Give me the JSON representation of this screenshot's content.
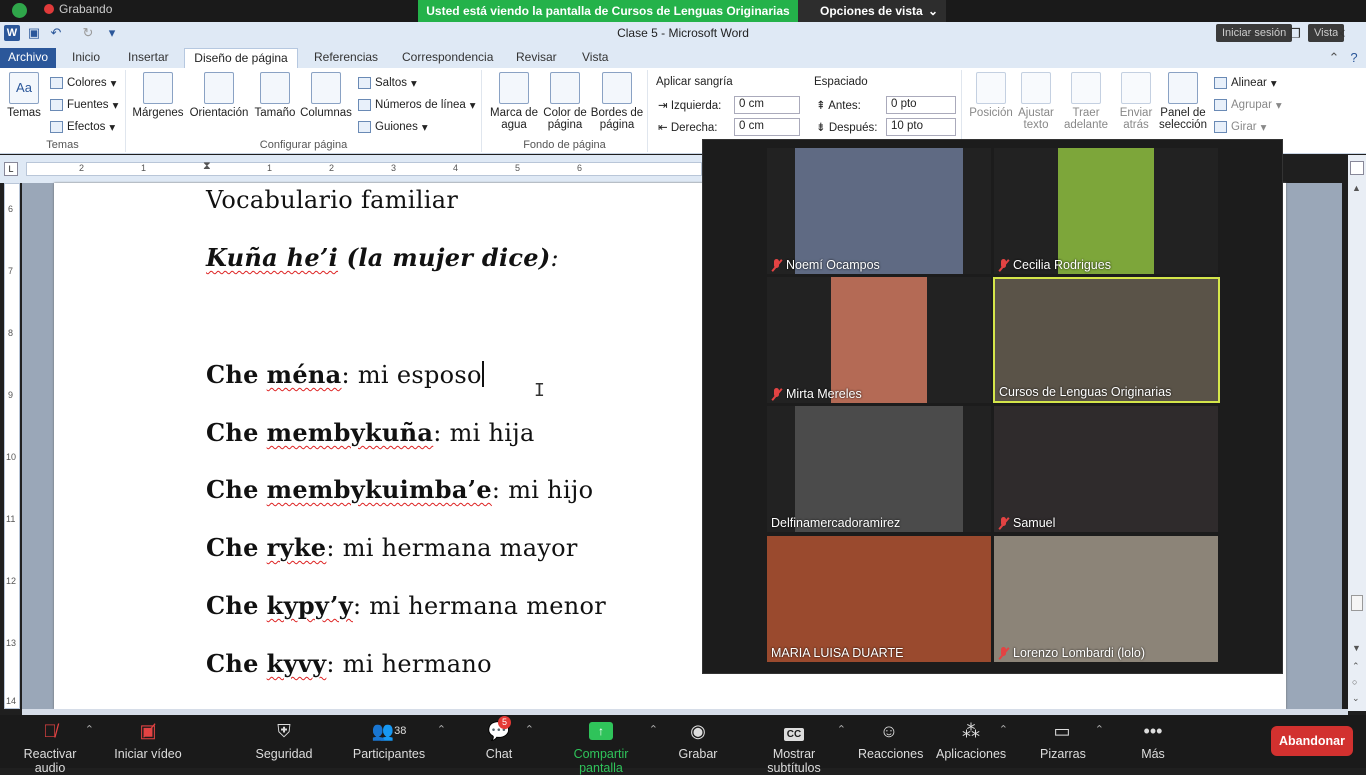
{
  "zoom_top": {
    "recording_label": "Grabando",
    "share_banner": "Usted está viendo la pantalla de Cursos de Lenguas Originarias",
    "view_options": "Opciones de vista",
    "sign_in": "Iniciar sesión",
    "view": "Vista"
  },
  "word": {
    "title": "Clase 5 - Microsoft Word",
    "tabs": [
      "Archivo",
      "Inicio",
      "Insertar",
      "Diseño de página",
      "Referencias",
      "Correspondencia",
      "Revisar",
      "Vista"
    ],
    "active_tab": "Diseño de página"
  },
  "ribbon": {
    "themes": {
      "temas": "Temas",
      "colores": "Colores",
      "fuentes": "Fuentes",
      "efectos": "Efectos",
      "group": "Temas"
    },
    "page_setup": {
      "margenes": "Márgenes",
      "orientacion": "Orientación",
      "tamano": "Tamaño",
      "columnas": "Columnas",
      "saltos": "Saltos",
      "numeros_linea": "Números de línea",
      "guiones": "Guiones",
      "group": "Configurar página"
    },
    "background": {
      "marca_agua_1": "Marca de",
      "marca_agua_2": "agua",
      "color_pagina_1": "Color de",
      "color_pagina_2": "página",
      "bordes_1": "Bordes de",
      "bordes_2": "página",
      "group": "Fondo de página"
    },
    "paragraph": {
      "sangria": "Aplicar sangría",
      "izquierda": "Izquierda:",
      "izquierda_val": "0 cm",
      "derecha": "Derecha:",
      "derecha_val": "0 cm",
      "espaciado": "Espaciado",
      "antes": "Antes:",
      "antes_val": "0 pto",
      "despues": "Después:",
      "despues_val": "10 pto"
    },
    "arrange": {
      "posicion": "Posición",
      "ajustar_1": "Ajustar",
      "ajustar_2": "texto",
      "traer_1": "Traer",
      "traer_2": "adelante",
      "enviar_1": "Enviar",
      "enviar_2": "atrás",
      "panel_1": "Panel de",
      "panel_2": "selección",
      "alinear": "Alinear",
      "agrupar": "Agrupar",
      "girar": "Girar"
    }
  },
  "ruler_numbers": [
    "2",
    "1",
    "1",
    "2",
    "3",
    "4",
    "5",
    "6"
  ],
  "vruler_numbers": [
    "6",
    "7",
    "8",
    "9",
    "10",
    "11",
    "12",
    "13",
    "14"
  ],
  "document": {
    "title": "Vocabulario familiar",
    "subtitle_bold": "Kuña he’i",
    "subtitle_rest": " (la mujer dice)",
    "subtitle_colon": ":",
    "lines": [
      {
        "che": "Che",
        "word": "ména",
        "rest": ": mi esposo"
      },
      {
        "che": "Che",
        "word": "membykuña",
        "rest": ": mi hija"
      },
      {
        "che": "Che",
        "word": "membykuimba’e",
        "rest": ": mi hijo"
      },
      {
        "che": "Che",
        "word": "ryke",
        "rest": ": mi hermana mayor"
      },
      {
        "che": "Che",
        "word": "kypy’y",
        "rest": ": mi hermana menor"
      },
      {
        "che": "Che",
        "word": "kyvy",
        "rest": ": mi hermano"
      }
    ]
  },
  "participants_tiles": [
    {
      "name": "Noemí Ocampos",
      "muted": true
    },
    {
      "name": "Cecilia Rodrigues",
      "muted": true
    },
    {
      "name": "Mirta Mereles",
      "muted": true
    },
    {
      "name": "Cursos de Lenguas Originarias",
      "muted": false
    },
    {
      "name": "Delfinamercadoramirez",
      "muted": false
    },
    {
      "name": "Samuel",
      "muted": true
    },
    {
      "name": "MARIA LUISA DUARTE",
      "muted": false
    },
    {
      "name": "Lorenzo Lombardi (lolo)",
      "muted": true
    }
  ],
  "zoom_bar": {
    "audio": "Reactivar audio",
    "video": "Iniciar vídeo",
    "security": "Seguridad",
    "participants": "Participantes",
    "participants_count": "38",
    "chat": "Chat",
    "chat_badge": "5",
    "share": "Compartir pantalla",
    "record": "Grabar",
    "captions": "Mostrar subtítulos",
    "captions_badge": "CC",
    "reactions": "Reacciones",
    "apps": "Aplicaciones",
    "whiteboards": "Pizarras",
    "more": "Más",
    "leave": "Abandonar"
  },
  "colors": {
    "zoom_green": "#24b24a",
    "word_blue": "#2b579a",
    "leave_red": "#d2312f",
    "mute_red": "#e34343"
  }
}
